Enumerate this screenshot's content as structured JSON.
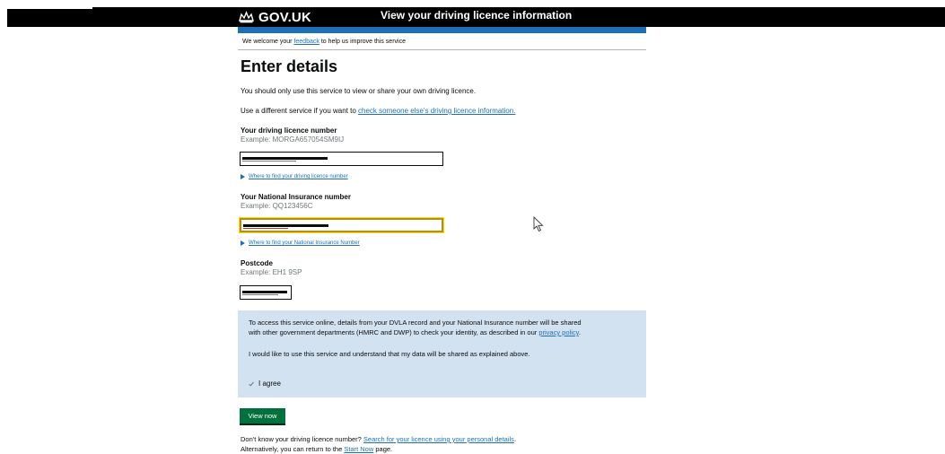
{
  "header": {
    "logo_text": "GOV.UK",
    "service_name": "View your driving licence information"
  },
  "feedback": {
    "before": "We welcome your ",
    "link": "feedback",
    "after": " to help us improve this service"
  },
  "page_title": "Enter details",
  "intro": {
    "line1": "You should only use this service to view or share your own driving licence.",
    "line2_before": "Use a different service if you want to ",
    "line2_link": "check someone else's driving licence information."
  },
  "licence": {
    "label": "Your driving licence number",
    "hint": "Example: MORGA657054SM9IJ",
    "help_link": "Where to find your driving licence number"
  },
  "ni": {
    "label": "Your National Insurance number",
    "hint": "Example: QQ123456C",
    "help_link": "Where to find your National Insurance Number"
  },
  "postcode": {
    "label": "Postcode",
    "hint": "Example: EH1 9SP"
  },
  "consent": {
    "para1_before": "To access this service online, details from your DVLA record and your National Insurance number will be shared",
    "para1_line2": "with other government departments (HMRC and DWP) to check your identity, as described in our ",
    "para1_link": "privacy policy",
    "para1_end": ".",
    "para2": "I would like to use this service and understand that my data will be shared as explained above.",
    "agree_label": "I agree"
  },
  "submit_label": "View now",
  "footer": {
    "line1_before": "Don't know your driving licence number? ",
    "line1_link": "Search for your licence using your personal details",
    "line1_end": ".",
    "line2_before": "Alternatively, you can return to the ",
    "line2_link": "Start Now",
    "line2_end": " page."
  },
  "colors": {
    "brand_blue": "#1d70b8",
    "button_green": "#00703c",
    "panel_blue": "#d2e2f1",
    "focus_yellow": "#ffdd00"
  }
}
